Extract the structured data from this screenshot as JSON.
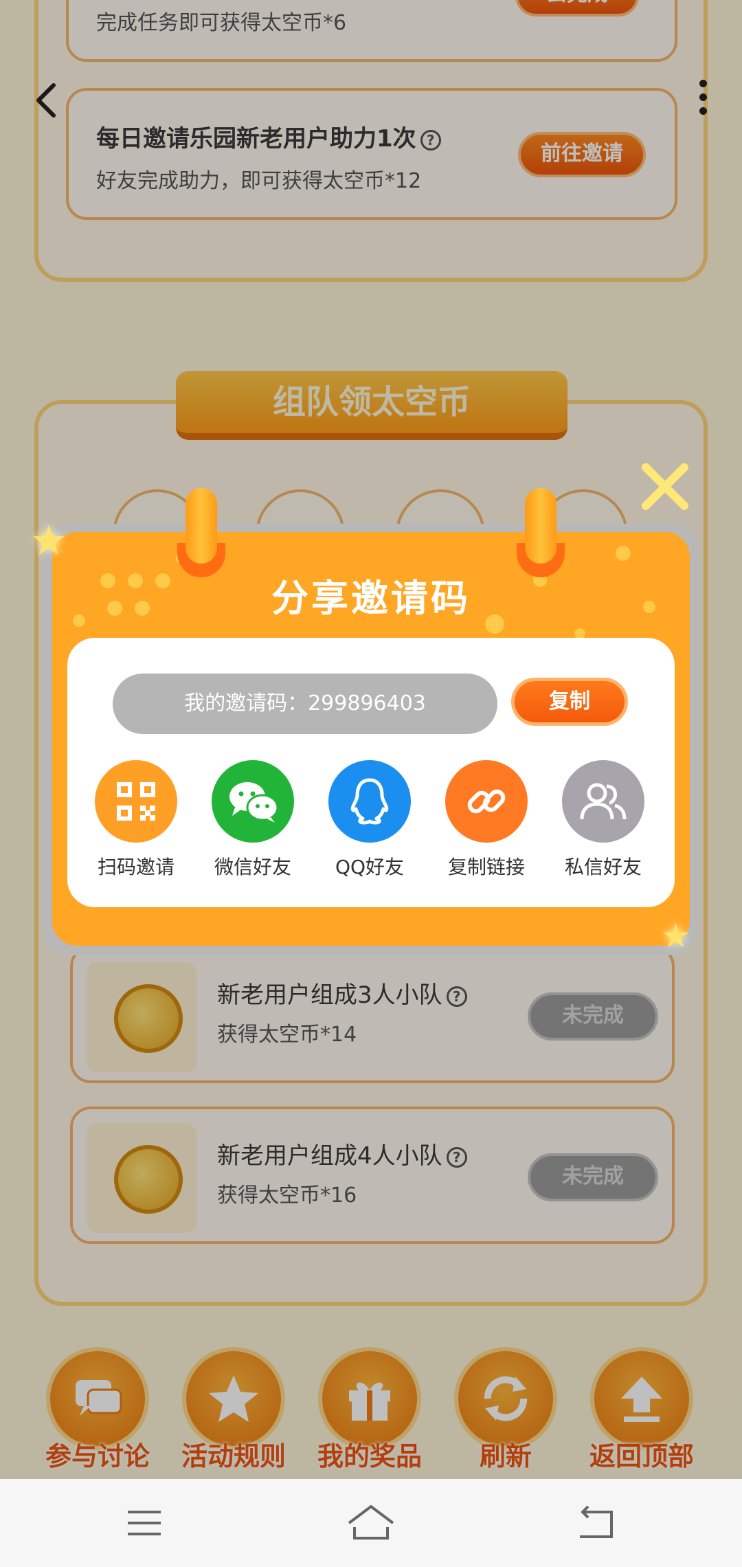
{
  "page": {
    "top_task": {
      "subtitle": "完成任务即可获得太空币*6",
      "button": "去完成"
    },
    "invite_task": {
      "title": "每日邀请乐园新老用户助力1次",
      "subtitle": "好友完成助力，即可获得太空币*12",
      "button": "前往邀请"
    },
    "team_banner": "组队领太空币",
    "team_tasks": [
      {
        "title": "新老用户组成3人小队",
        "reward": "获得太空币*14",
        "status": "未完成"
      },
      {
        "title": "新老用户组成4人小队",
        "reward": "获得太空币*16",
        "status": "未完成"
      }
    ],
    "help_mark": "?"
  },
  "bottom_bar": [
    {
      "label": "参与讨论",
      "icon": "chat-icon"
    },
    {
      "label": "活动规则",
      "icon": "star-icon"
    },
    {
      "label": "我的奖品",
      "icon": "gift-icon"
    },
    {
      "label": "刷新",
      "icon": "refresh-icon"
    },
    {
      "label": "返回顶部",
      "icon": "upload-icon"
    }
  ],
  "dialog": {
    "title": "分享邀请码",
    "invite_code_text": "我的邀请码：299896403",
    "copy_button": "复制",
    "share_options": [
      {
        "label": "扫码邀请",
        "icon": "qr-code-icon",
        "color": "#ff9f26"
      },
      {
        "label": "微信好友",
        "icon": "wechat-icon",
        "color": "#22b438"
      },
      {
        "label": "QQ好友",
        "icon": "qq-penguin-icon",
        "color": "#1a8ff0"
      },
      {
        "label": "复制链接",
        "icon": "link-icon",
        "color": "#ff7a22"
      },
      {
        "label": "私信好友",
        "icon": "users-icon",
        "color": "#a7a5ab"
      }
    ]
  },
  "colors": {
    "dialog_orange": "#ffa624",
    "accent_orange": "#f0560d",
    "page_bg": "#fdf3d7"
  }
}
